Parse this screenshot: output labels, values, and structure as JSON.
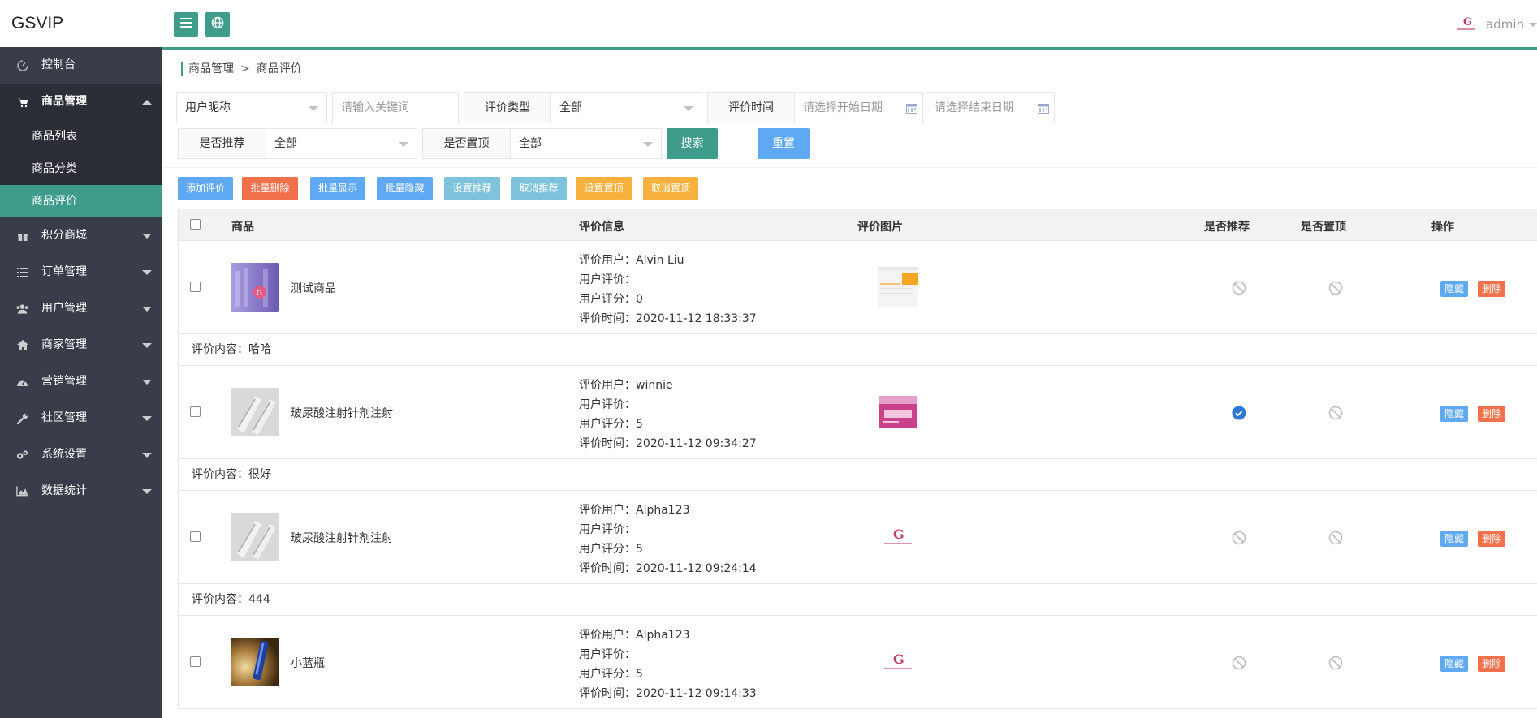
{
  "app_title": "GSVIP",
  "colors": {
    "accent": "#3f9b8a",
    "sidebar_bg": "#393d49",
    "sidebar_open_bg": "#2b2e37",
    "blue": "#5fa8f2",
    "red": "#f0714b",
    "teal_light": "#7ec3db",
    "orange": "#f6b23c",
    "check_blue": "#2f79d6"
  },
  "header": {
    "menu_icon": "hamburger-icon",
    "globe_icon": "globe-icon",
    "user_name": "admin"
  },
  "sidebar": {
    "items": [
      {
        "label": "控制台",
        "icon": "dashboard-icon"
      },
      {
        "label": "商品管理",
        "icon": "cart-icon",
        "open": true,
        "children": [
          "商品列表",
          "商品分类",
          "商品评价"
        ]
      },
      {
        "label": "积分商城",
        "icon": "gift-icon"
      },
      {
        "label": "订单管理",
        "icon": "list-icon"
      },
      {
        "label": "用户管理",
        "icon": "users-icon"
      },
      {
        "label": "商家管理",
        "icon": "home-icon"
      },
      {
        "label": "营销管理",
        "icon": "gauge-icon"
      },
      {
        "label": "社区管理",
        "icon": "wrench-icon"
      },
      {
        "label": "系统设置",
        "icon": "gears-icon"
      },
      {
        "label": "数据统计",
        "icon": "area-chart-icon"
      }
    ]
  },
  "breadcrumb": {
    "parent": "商品管理",
    "separator": ">",
    "current": "商品评价"
  },
  "filters": {
    "field_select": "用户昵称",
    "keyword_placeholder": "请输入关键词",
    "type_label": "评价类型",
    "type_value": "全部",
    "time_label": "评价时间",
    "start_placeholder": "请选择开始日期",
    "end_placeholder": "请选择结束日期",
    "recommend_label": "是否推荐",
    "recommend_value": "全部",
    "top_label": "是否置顶",
    "top_value": "全部",
    "search": "搜索",
    "reset": "重置"
  },
  "toolbar": {
    "add": "添加评价",
    "batch_delete": "批量删除",
    "batch_show": "批量显示",
    "batch_hide": "批量隐藏",
    "set_recommend": "设置推荐",
    "cancel_recommend": "取消推荐",
    "set_top": "设置置顶",
    "cancel_top": "取消置顶"
  },
  "table": {
    "headers": {
      "product": "商品",
      "info": "评价信息",
      "images": "评价图片",
      "recommend": "是否推荐",
      "top": "是否置顶",
      "actions": "操作"
    },
    "labels": {
      "user": "评价用户：",
      "comment": "用户评价：",
      "score": "用户评分：",
      "time": "评价时间：",
      "content": "评价内容："
    },
    "actions": {
      "hide": "隐藏",
      "delete": "删除"
    },
    "rows": [
      {
        "product": "测试商品",
        "user": "Alvin Liu",
        "score": "0",
        "time": "2020-11-12 18:33:37",
        "content": "哈哈",
        "recommend": false,
        "top": false
      },
      {
        "product": "玻尿酸注射针剂注射",
        "user": "winnie",
        "score": "5",
        "time": "2020-11-12 09:34:27",
        "content": "很好",
        "recommend": true,
        "top": false
      },
      {
        "product": "玻尿酸注射针剂注射",
        "user": "Alpha123",
        "score": "5",
        "time": "2020-11-12 09:24:14",
        "content": "444",
        "recommend": false,
        "top": false
      },
      {
        "product": "小蓝瓶",
        "user": "Alpha123",
        "score": "5",
        "time": "2020-11-12 09:14:33",
        "content": "",
        "recommend": false,
        "top": false
      }
    ]
  }
}
